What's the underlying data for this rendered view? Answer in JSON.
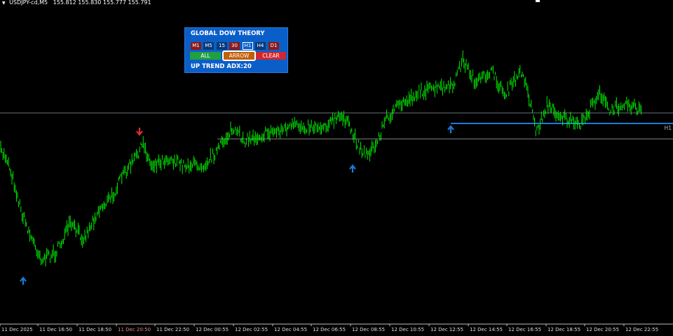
{
  "chart_header": {
    "symbol": "USDJPY-cd,M5",
    "ohlc": "155.812 155.830 155.777 155.791"
  },
  "panel": {
    "title": "GLOBAL DOW THEORY",
    "timeframes": [
      "M1",
      "M5",
      "15",
      "30",
      "H1",
      "H4",
      "D1"
    ],
    "selected_timeframe": "H1",
    "buttons": {
      "all": "ALL",
      "arrow": "ARROW",
      "clear": "CLEAR"
    },
    "status": "UP TREND  ADX:20"
  },
  "line_label": "H1",
  "x_axis": [
    "11 Dec 2025",
    "11 Dec 16:50",
    "11 Dec 18:50",
    "11 Dec 20:50",
    "11 Dec 22:50",
    "12 Dec 00:55",
    "12 Dec 02:55",
    "12 Dec 04:55",
    "12 Dec 06:55",
    "12 Dec 08:55",
    "12 Dec 10:55",
    "12 Dec 12:55",
    "12 Dec 14:55",
    "12 Dec 16:55",
    "12 Dec 18:55",
    "12 Dec 20:55",
    "12 Dec 22:55"
  ],
  "colors": {
    "candles": "#00ff00",
    "up_arrow": "#1a7ad8",
    "down_arrow": "#e03030",
    "trend_line": "#1a7ad8",
    "panel": "#0a5ec8"
  }
}
